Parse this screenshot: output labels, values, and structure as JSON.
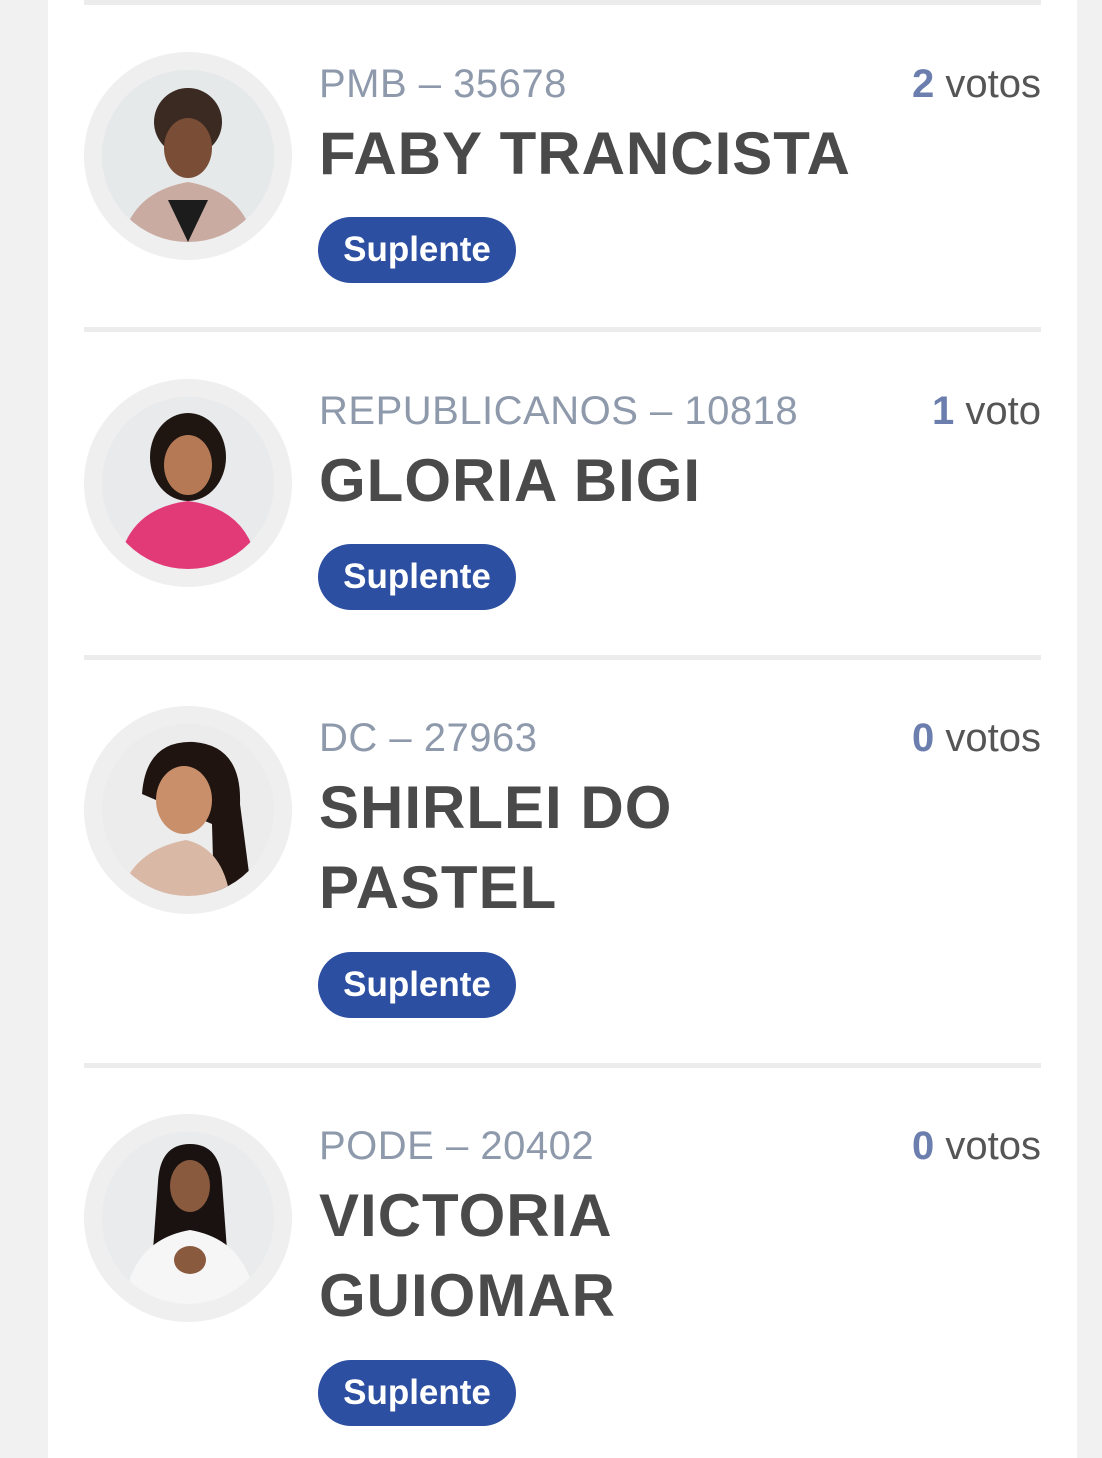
{
  "candidates": [
    {
      "party_number": "PMB – 35678",
      "name": "FABY TRANCISTA",
      "votes_count": "2",
      "votes_unit": "votos",
      "status": "Suplente"
    },
    {
      "party_number": "REPUBLICANOS – 10818",
      "name": "GLORIA BIGI",
      "votes_count": "1",
      "votes_unit": "voto",
      "status": "Suplente"
    },
    {
      "party_number": "DC – 27963",
      "name": "SHIRLEI DO PASTEL",
      "votes_count": "0",
      "votes_unit": "votos",
      "status": "Suplente"
    },
    {
      "party_number": "PODE – 20402",
      "name": "VICTORIA GUIOMAR",
      "votes_count": "0",
      "votes_unit": "votos",
      "status": "Suplente"
    }
  ],
  "colors": {
    "badge_background": "#2d4fa1",
    "vote_number": "#6b7eae",
    "party_text": "#8e9aab",
    "name_text": "#4a4a4a"
  }
}
